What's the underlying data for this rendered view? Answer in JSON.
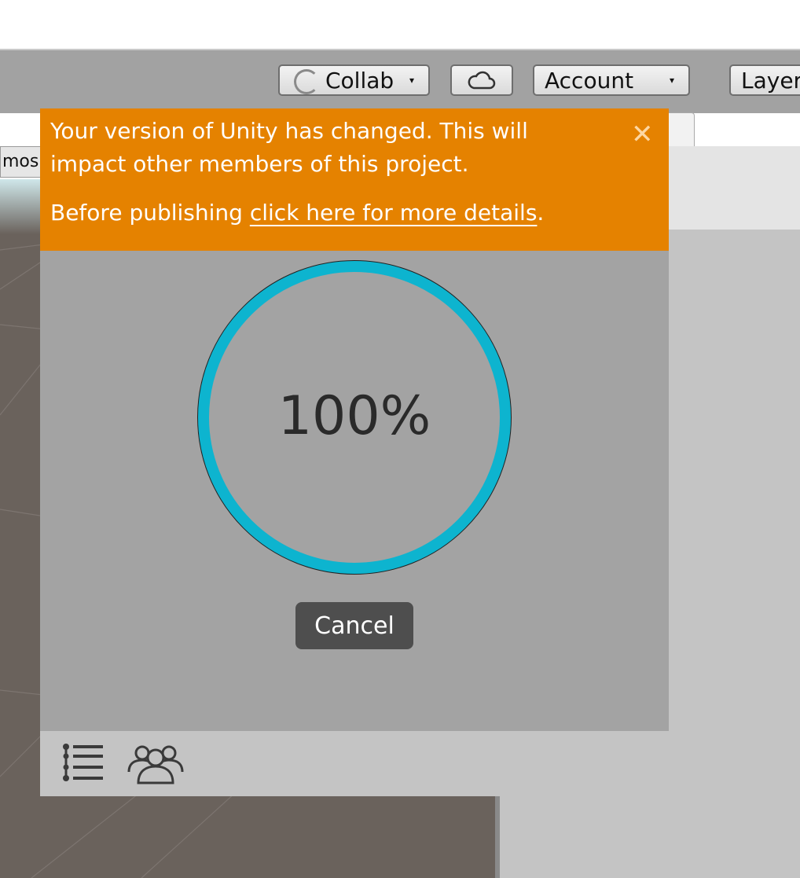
{
  "toolbar": {
    "collab_label": "Collab",
    "collab_caret": "▾",
    "cloud_icon": "cloud-icon",
    "account_label": "Account",
    "account_caret": "▾",
    "layers_label": "Layer"
  },
  "scene": {
    "tab_label": "mos"
  },
  "collab_panel": {
    "banner": {
      "message": "Your version of Unity has changed. This will impact other members of this project.",
      "prefix": "Before publishing ",
      "link_text": "click here for more details",
      "suffix": ".",
      "close_symbol": "✕",
      "color": "#e58200"
    },
    "progress": {
      "percent_text": "100%",
      "value": 1.0,
      "ring_color": "#0db4cf"
    },
    "cancel_label": "Cancel",
    "footer_icons": [
      "list-icon",
      "people-icon"
    ]
  }
}
